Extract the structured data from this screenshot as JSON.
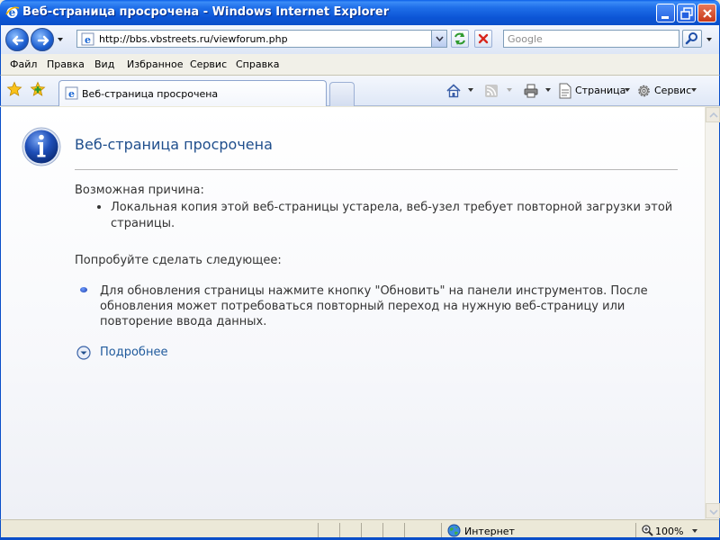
{
  "window": {
    "title": "Веб-страница просрочена - Windows Internet Explorer"
  },
  "address_bar": {
    "url": "http://bbs.vbstreets.ru/viewforum.php"
  },
  "search": {
    "placeholder": "Google"
  },
  "menu": {
    "items": [
      "Файл",
      "Правка",
      "Вид",
      "Избранное",
      "Сервис",
      "Справка"
    ]
  },
  "tabs": [
    {
      "label": "Веб-страница просрочена"
    }
  ],
  "command_bar": {
    "page_label": "Страница",
    "tools_label": "Сервис"
  },
  "content": {
    "title": "Веб-страница просрочена",
    "reason_heading": "Возможная причина:",
    "reason_text": "Локальная копия этой веб-страницы устарела, веб-узел требует повторной загрузки этой страницы.",
    "try_heading": "Попробуйте сделать следующее:",
    "try_text": "Для обновления страницы нажмите кнопку \"Обновить\" на панели инструментов. После обновления может потребоваться повторный переход на нужную веб-страницу или повторение ввода данных.",
    "more_link": "Подробнее"
  },
  "status_bar": {
    "zone": "Интернет",
    "zoom": "100%"
  },
  "icons": {
    "ie": "ie-logo-icon",
    "info": "info-icon",
    "back": "back-arrow-icon",
    "forward": "forward-arrow-icon",
    "refresh": "refresh-icon",
    "stop": "stop-icon",
    "search": "search-icon",
    "favorites": "favorites-star-icon",
    "add_favorite": "add-favorite-icon",
    "home": "home-icon",
    "feeds": "rss-feed-icon",
    "print": "print-icon",
    "page": "page-icon",
    "tools": "gear-icon",
    "globe": "globe-icon",
    "zoom": "zoom-icon",
    "more": "chevron-down-circle-icon"
  },
  "colors": {
    "titlebar": "#0c55d6",
    "heading": "#1f4e8c",
    "link": "#1f5a9c"
  }
}
